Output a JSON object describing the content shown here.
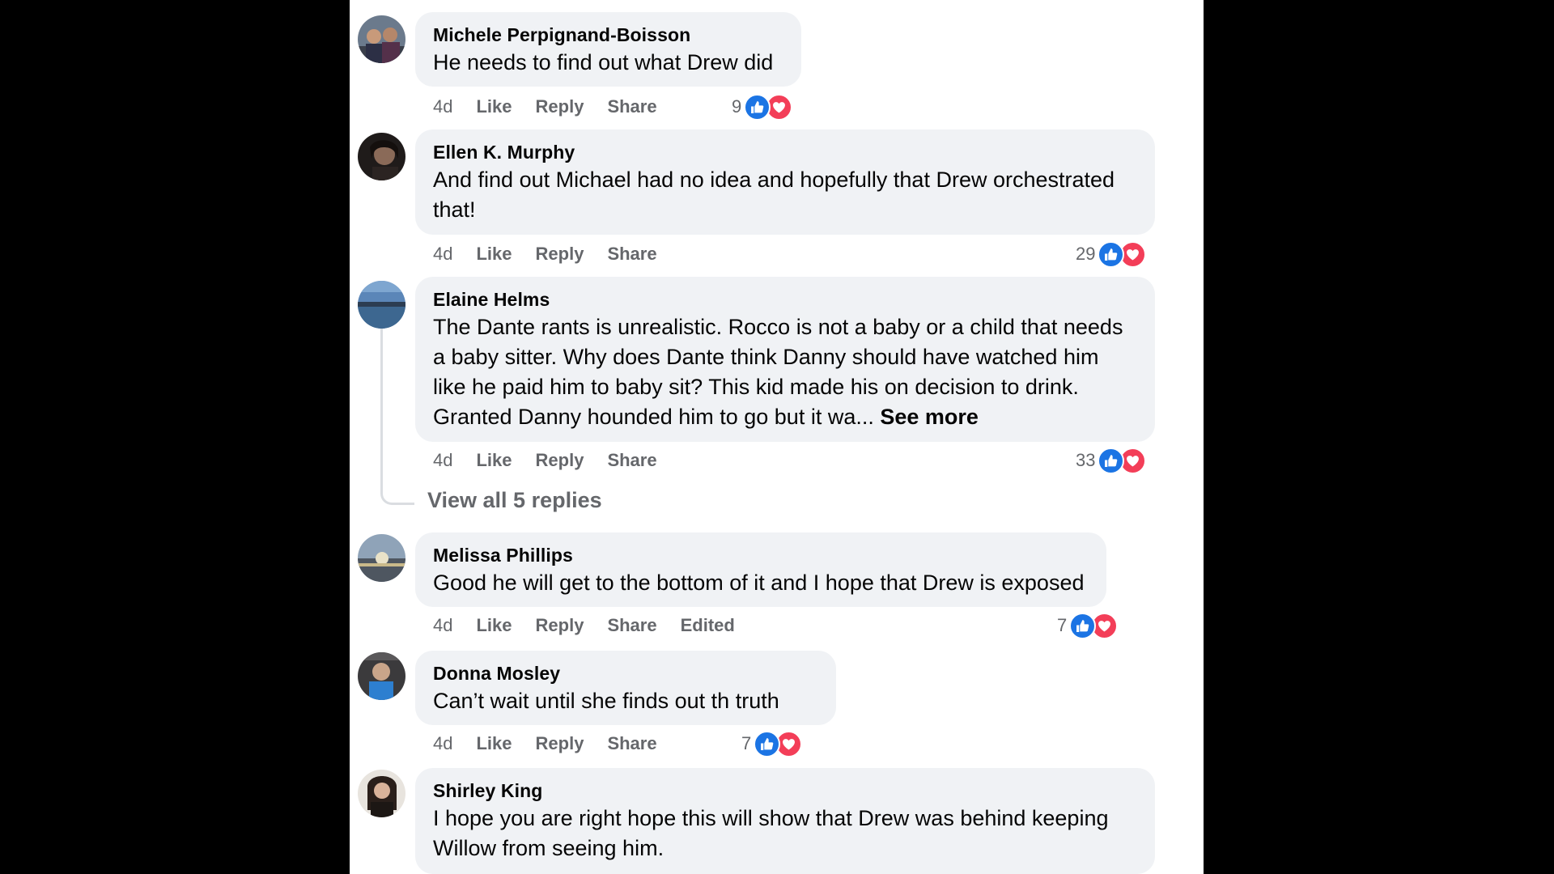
{
  "comments": [
    {
      "author": "Michele Perpignand-Boisson",
      "text": "He needs to find out what Drew did",
      "time": "4d",
      "like": "Like",
      "reply": "Reply",
      "share": "Share",
      "reaction_count": "9"
    },
    {
      "author": "Ellen K. Murphy",
      "text": "And find out Michael had no idea and hopefully that Drew orchestrated that!",
      "time": "4d",
      "like": "Like",
      "reply": "Reply",
      "share": "Share",
      "reaction_count": "29"
    },
    {
      "author": "Elaine Helms",
      "text": "The Dante rants is unrealistic. Rocco is not a baby or a child that needs a baby sitter. Why does Dante think Danny should have watched him like he paid him to baby sit? This kid made his on decision to drink. Granted Danny hounded him to go but it wa...",
      "see_more": "See more",
      "time": "4d",
      "like": "Like",
      "reply": "Reply",
      "share": "Share",
      "reaction_count": "33",
      "view_replies": "View all 5 replies"
    },
    {
      "author": "Melissa Phillips",
      "text": "Good he will get to the bottom of it and I hope that Drew is exposed",
      "time": "4d",
      "like": "Like",
      "reply": "Reply",
      "share": "Share",
      "edited": "Edited",
      "reaction_count": "7"
    },
    {
      "author": "Donna Mosley",
      "text": "Can’t wait until she finds out th truth",
      "time": "4d",
      "like": "Like",
      "reply": "Reply",
      "share": "Share",
      "reaction_count": "7"
    },
    {
      "author": "Shirley King",
      "text": "I hope you are right hope this will show that Drew was behind keeping Willow from seeing him."
    }
  ],
  "colors": {
    "background": "#000000",
    "panel": "#ffffff",
    "bubble": "#f0f2f5",
    "like_blue": "#1b74e4",
    "love_red": "#f33e58",
    "secondary_text": "#65676b"
  },
  "icons": {
    "like": "thumbs-up-icon",
    "love": "heart-icon"
  }
}
